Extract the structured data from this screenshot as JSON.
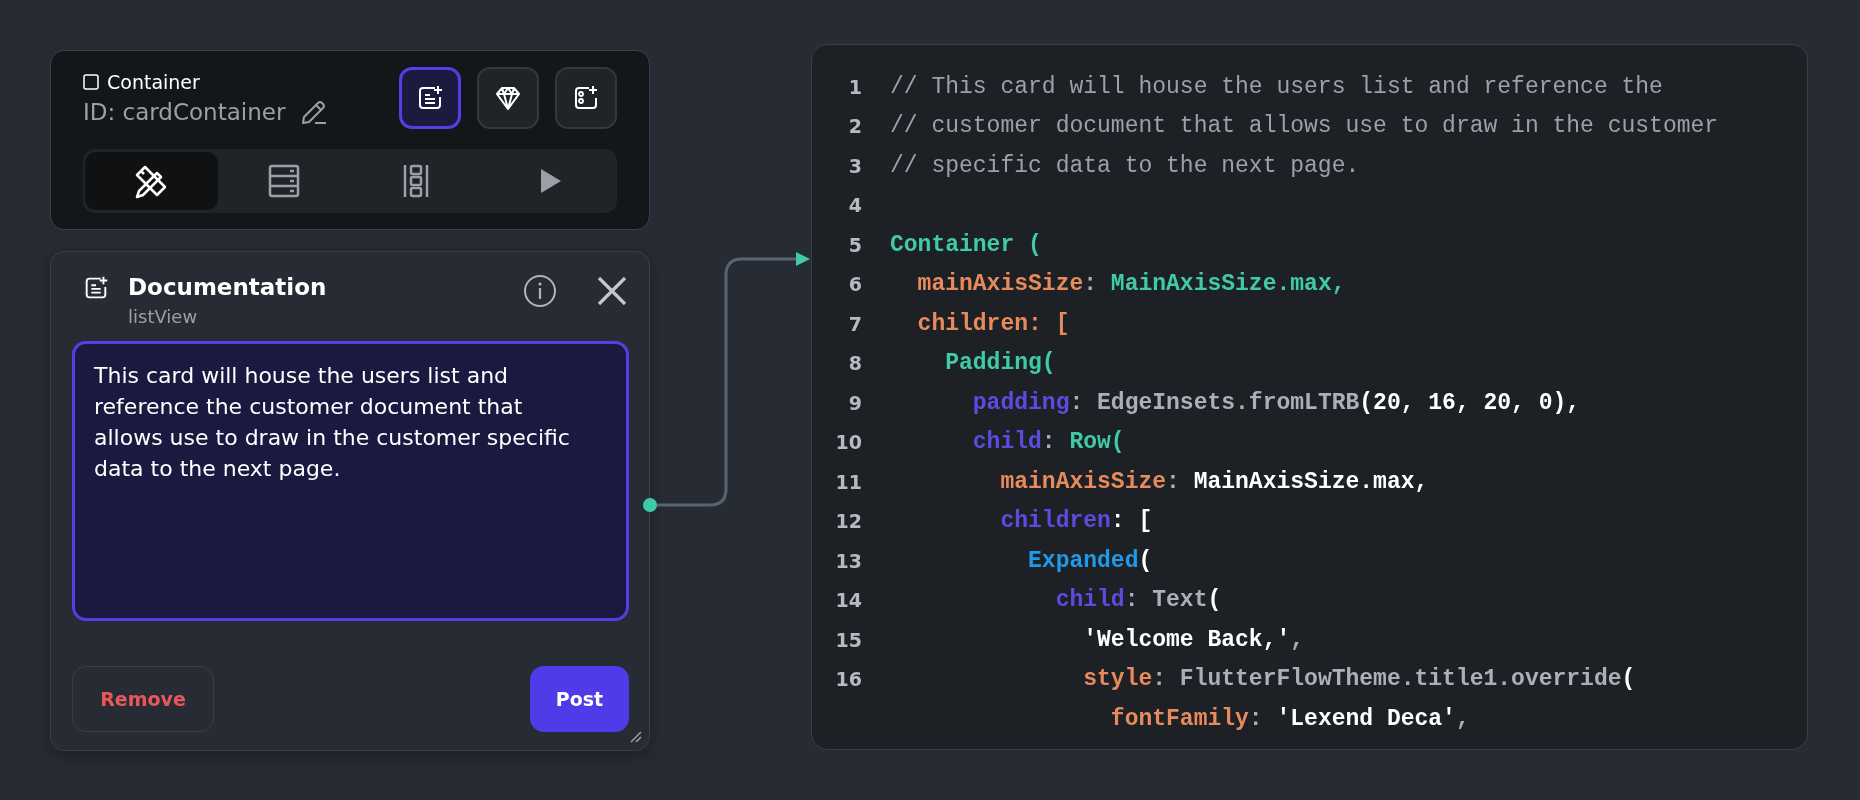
{
  "element_card": {
    "type_label": "Container",
    "id_label": "ID: cardContainer",
    "action_buttons": [
      {
        "selected": true
      },
      {
        "selected": false
      },
      {
        "selected": false
      }
    ],
    "tabs": [
      {
        "selected": true
      },
      {
        "selected": false
      },
      {
        "selected": false
      },
      {
        "selected": false
      }
    ]
  },
  "documentation": {
    "title": "Documentation",
    "subtitle": "listView",
    "note": "This card will house the users list and reference the customer document that allows use to draw in the customer specific data to the next page.",
    "buttons": [
      {
        "label": "Remove",
        "kind": "danger"
      },
      {
        "label": "Post",
        "kind": "primary"
      }
    ]
  },
  "code": {
    "lines": [
      {
        "number": "1",
        "tokens": [
          {
            "text": "// This card will house the users list and reference the",
            "kind": "comment"
          }
        ]
      },
      {
        "number": "2",
        "tokens": [
          {
            "text": "// customer document that allows use to draw in the customer",
            "kind": "comment"
          }
        ]
      },
      {
        "number": "3",
        "tokens": [
          {
            "text": "// specific data to the next page.",
            "kind": "comment"
          }
        ]
      },
      {
        "number": "4"
      },
      {
        "number": "5",
        "tokens": [
          {
            "text": "Container (",
            "kind": "widget"
          }
        ]
      },
      {
        "number": "6",
        "tokens": [
          {
            "text": "  mainAxisSize",
            "kind": "prop"
          },
          {
            "text": ": ",
            "kind": "muted"
          },
          {
            "text": "MainAxisSize.max,",
            "kind": "widget"
          }
        ]
      },
      {
        "number": "7",
        "tokens": [
          {
            "text": "  children: [",
            "kind": "prop"
          }
        ]
      },
      {
        "number": "8",
        "tokens": [
          {
            "text": "    Padding(",
            "kind": "widget"
          }
        ]
      },
      {
        "number": "9",
        "tokens": [
          {
            "text": "      padding",
            "kind": "key"
          },
          {
            "text": ": EdgeInsets.fromLTRB",
            "kind": "muted"
          },
          {
            "text": "(20, 16, 20, 0),",
            "kind": "plain"
          }
        ]
      },
      {
        "number": "10",
        "tokens": [
          {
            "text": "      child",
            "kind": "key"
          },
          {
            "text": ": ",
            "kind": "muted"
          },
          {
            "text": "Row(",
            "kind": "widget"
          }
        ]
      },
      {
        "number": "11",
        "tokens": [
          {
            "text": "        mainAxisSize",
            "kind": "prop"
          },
          {
            "text": ": ",
            "kind": "muted"
          },
          {
            "text": "MainAxisSize.max,",
            "kind": "plain"
          }
        ]
      },
      {
        "number": "12",
        "tokens": [
          {
            "text": "        children",
            "kind": "key"
          },
          {
            "text": ": [",
            "kind": "plain"
          }
        ]
      },
      {
        "number": "13",
        "tokens": [
          {
            "text": "          Expanded",
            "kind": "type"
          },
          {
            "text": "(",
            "kind": "plain"
          }
        ]
      },
      {
        "number": "14",
        "tokens": [
          {
            "text": "            child",
            "kind": "key"
          },
          {
            "text": ": Text",
            "kind": "muted"
          },
          {
            "text": "(",
            "kind": "plain"
          }
        ]
      },
      {
        "number": "15",
        "tokens": [
          {
            "text": "              'Welcome Back,'",
            "kind": "plain"
          },
          {
            "text": ",",
            "kind": "muted"
          }
        ]
      },
      {
        "number": "16",
        "tokens": [
          {
            "text": "              style",
            "kind": "prop"
          },
          {
            "text": ": FlutterFlowTheme.title1.override",
            "kind": "muted"
          },
          {
            "text": "(",
            "kind": "plain"
          }
        ]
      },
      {
        "tokens": [
          {
            "text": "                fontFamily",
            "kind": "prop"
          },
          {
            "text": ": ",
            "kind": "muted"
          },
          {
            "text": "'Lexend Deca'",
            "kind": "plain"
          },
          {
            "text": ",",
            "kind": "muted"
          }
        ]
      }
    ]
  }
}
